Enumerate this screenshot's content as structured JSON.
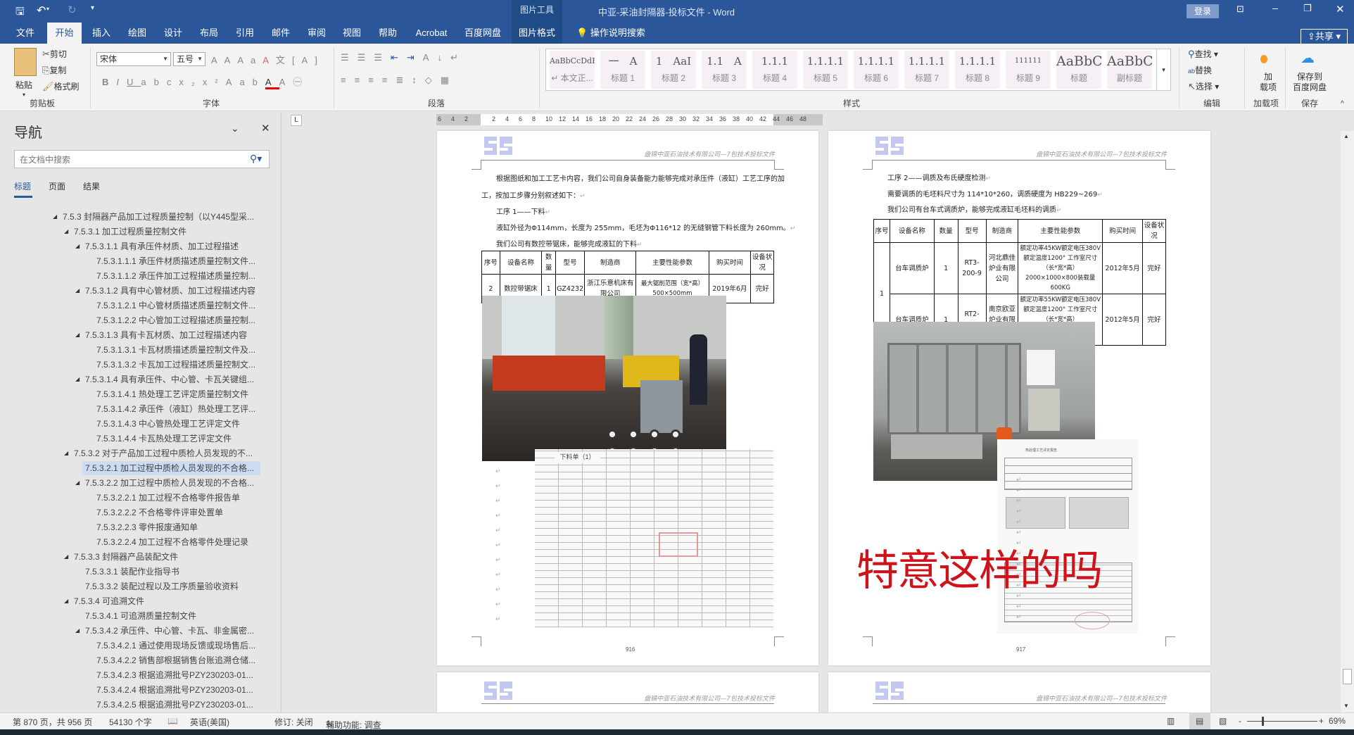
{
  "titlebar": {
    "contextual_group": "图片工具",
    "title": "中亚-采油封隔器-投标文件 - Word",
    "login": "登录"
  },
  "tabs": [
    "文件",
    "开始",
    "插入",
    "绘图",
    "设计",
    "布局",
    "引用",
    "邮件",
    "审阅",
    "视图",
    "帮助",
    "Acrobat",
    "百度网盘",
    "图片格式"
  ],
  "tell_me": "操作说明搜索",
  "share": "共享",
  "ribbon": {
    "clipboard": {
      "label": "剪贴板",
      "paste": "粘贴",
      "cut": "剪切",
      "copy": "复制",
      "format_painter": "格式刷"
    },
    "font": {
      "label": "字体",
      "name": "宋体",
      "size": "五号"
    },
    "paragraph": {
      "label": "段落"
    },
    "styles": {
      "label": "样式",
      "items": [
        {
          "preview": "AaBbCcDdE",
          "name": "↵ 本文正..."
        },
        {
          "preview": "一　A",
          "name": "标题 1"
        },
        {
          "preview": "1　AaI",
          "name": "标题 2"
        },
        {
          "preview": "1.1　A",
          "name": "标题 3"
        },
        {
          "preview": "1.1.1",
          "name": "标题 4"
        },
        {
          "preview": "1.1.1.1",
          "name": "标题 5"
        },
        {
          "preview": "1.1.1.1",
          "name": "标题 6"
        },
        {
          "preview": "1.1.1.1",
          "name": "标题 7"
        },
        {
          "preview": "1.1.1.1",
          "name": "标题 8"
        },
        {
          "preview": "111111",
          "name": "标题 9"
        },
        {
          "preview": "AaBbC",
          "name": "标题"
        },
        {
          "preview": "AaBbC",
          "name": "副标题"
        }
      ]
    },
    "editing": {
      "label": "编辑",
      "find": "查找",
      "replace": "替换",
      "select": "选择"
    },
    "addins": {
      "label": "加载项",
      "button_line1": "加",
      "button_line2": "载项"
    },
    "save": {
      "label": "保存",
      "button_line1": "保存到",
      "button_line2": "百度网盘"
    }
  },
  "nav": {
    "title": "导航",
    "search_placeholder": "在文档中搜索",
    "tabs": [
      "标题",
      "页面",
      "结果"
    ],
    "items": [
      {
        "text": "7.5.3 封隔器产品加工过程质量控制（以Y445型采...",
        "level": 1,
        "expanded": true
      },
      {
        "text": "7.5.3.1 加工过程质量控制文件",
        "level": 2,
        "expanded": true
      },
      {
        "text": "7.5.3.1.1 具有承压件材质、加工过程描述",
        "level": 3,
        "expanded": true
      },
      {
        "text": "7.5.3.1.1.1 承压件材质描述质量控制文件...",
        "level": 4
      },
      {
        "text": "7.5.3.1.1.2 承压件加工过程描述质量控制...",
        "level": 4
      },
      {
        "text": "7.5.3.1.2 具有中心管材质、加工过程描述内容",
        "level": 3,
        "expanded": true
      },
      {
        "text": "7.5.3.1.2.1 中心管材质描述质量控制文件...",
        "level": 4
      },
      {
        "text": "7.5.3.1.2.2 中心管加工过程描述质量控制...",
        "level": 4
      },
      {
        "text": "7.5.3.1.3 具有卡瓦材质、加工过程描述内容",
        "level": 3,
        "expanded": true
      },
      {
        "text": "7.5.3.1.3.1 卡瓦材质描述质量控制文件及...",
        "level": 4
      },
      {
        "text": "7.5.3.1.3.2 卡瓦加工过程描述质量控制文...",
        "level": 4
      },
      {
        "text": "7.5.3.1.4 具有承压件、中心管、卡瓦关键组...",
        "level": 3,
        "expanded": true
      },
      {
        "text": "7.5.3.1.4.1 热处理工艺评定质量控制文件",
        "level": 4
      },
      {
        "text": "7.5.3.1.4.2 承压件（液缸）热处理工艺评...",
        "level": 4
      },
      {
        "text": "7.5.3.1.4.3 中心管热处理工艺评定文件",
        "level": 4
      },
      {
        "text": "7.5.3.1.4.4 卡瓦热处理工艺评定文件",
        "level": 4
      },
      {
        "text": "7.5.3.2 对于产品加工过程中质检人员发现的不...",
        "level": 2,
        "expanded": true
      },
      {
        "text": "7.5.3.2.1 加工过程中质检人员发现的不合格...",
        "level": 3,
        "selected": true
      },
      {
        "text": "7.5.3.2.2 加工过程中质检人员发现的不合格...",
        "level": 3,
        "expanded": true
      },
      {
        "text": "7.5.3.2.2.1 加工过程不合格零件报告单",
        "level": 4
      },
      {
        "text": "7.5.3.2.2.2 不合格零件评审处置单",
        "level": 4
      },
      {
        "text": "7.5.3.2.2.3 零件报废通知单",
        "level": 4
      },
      {
        "text": "7.5.3.2.2.4 加工过程不合格零件处理记录",
        "level": 4
      },
      {
        "text": "7.5.3.3 封隔器产品装配文件",
        "level": 2,
        "expanded": true
      },
      {
        "text": "7.5.3.3.1 装配作业指导书",
        "level": 3
      },
      {
        "text": "7.5.3.3.2 装配过程以及工序质量验收资料",
        "level": 3
      },
      {
        "text": "7.5.3.4 可追溯文件",
        "level": 2,
        "expanded": true
      },
      {
        "text": "7.5.3.4.1 可追溯质量控制文件",
        "level": 3
      },
      {
        "text": "7.5.3.4.2 承压件、中心管、卡瓦、非金属密...",
        "level": 3,
        "expanded": true
      },
      {
        "text": "7.5.3.4.2.1 通过使用现场反馈或现场售后...",
        "level": 4
      },
      {
        "text": "7.5.3.4.2.2 销售部根据销售台账追溯仓储...",
        "level": 4
      },
      {
        "text": "7.5.3.4.2.3 根据追溯批号PZY230203-01...",
        "level": 4
      },
      {
        "text": "7.5.3.4.2.4 根据追溯批号PZY230203-01...",
        "level": 4
      },
      {
        "text": "7.5.3.4.2.5 根据追溯批号PZY230203-01...",
        "level": 4
      }
    ]
  },
  "ruler": {
    "ticks_left": [
      "6",
      "4",
      "2"
    ],
    "ticks": [
      "2",
      "4",
      "6",
      "8",
      "10",
      "12",
      "14",
      "16",
      "18",
      "20",
      "22",
      "24",
      "26",
      "28",
      "30",
      "32",
      "34",
      "36",
      "38",
      "40",
      "42",
      "44",
      "46",
      "48"
    ]
  },
  "pages": [
    {
      "header": "盘锦中亚石油技术有限公司—7包技术投标文件",
      "paragraphs": [
        "根据图纸和加工工艺卡内容，我们公司自身装备能力能够完成对承压件（液缸）工艺工序的加",
        "工，按加工步骤分别叙述如下：",
        "工序 1——下料",
        "液缸外径为Φ114mm，长度为 255mm，毛坯为Φ116*12 的无缝钢管下料长度为 260mm。",
        "我们公司有数控带锯床，能够完成液缸的下料"
      ],
      "table": {
        "headers": [
          "序号",
          "设备名称",
          "数量",
          "型号",
          "制造商",
          "主要性能参数",
          "购买时间",
          "设备状况"
        ],
        "rows": [
          [
            "2",
            "数控带锯床",
            "1",
            "GZ4232",
            "浙江乐意机床有限公司",
            "最大锯削范围（宽*高）500×500mm",
            "2019年6月",
            "完好"
          ]
        ]
      },
      "scan_title": "下料单（1）",
      "page_number": "916"
    },
    {
      "header": "盘锦中亚石油技术有限公司—7包技术投标文件",
      "paragraphs": [
        "工序 2——调质及布氏硬度检测",
        "需要调质的毛坯料尺寸为 114*10*260，调质硬度为 HB229~269",
        "我们公司有台车式调质炉，能够完成液缸毛坯料的调质"
      ],
      "table": {
        "headers": [
          "序号",
          "设备名称",
          "数量",
          "型号",
          "制造商",
          "主要性能参数",
          "购买时间",
          "设备状况"
        ],
        "rows": [
          [
            "1",
            "台车调质炉",
            "1",
            "RT3-200-9",
            "河北鼎佳炉业有限公司",
            "额定功率45KW额定电压380V额定温度1200° 工作室尺寸（长*宽*高）2000×1000×800装载量600KG",
            "2012年5月",
            "完好"
          ],
          [
            "",
            "台车调质炉",
            "1",
            "RT2-380-12",
            "南京欧亚炉业有限责任公司",
            "额定功率55KW额定电压380V额定温度1200° 工作室尺寸（长*宽*高）2500×1200×800装载量700KG",
            "2012年5月",
            "完好"
          ]
        ]
      },
      "scan_title": "热处理工艺评定报告",
      "page_number": "917"
    }
  ],
  "overlay_text": "特意这样的吗",
  "status": {
    "page": "第 870 页，共 956 页",
    "words": "54130 个字",
    "language": "英语(美国)",
    "track_changes": "修订: 关闭",
    "accessibility": "辅助功能: 调查",
    "zoom": "69%"
  },
  "colors": {
    "title_bar": "#2b579a",
    "overlay_red": "#d0121b",
    "nav_selected": "#cbdcf3"
  }
}
